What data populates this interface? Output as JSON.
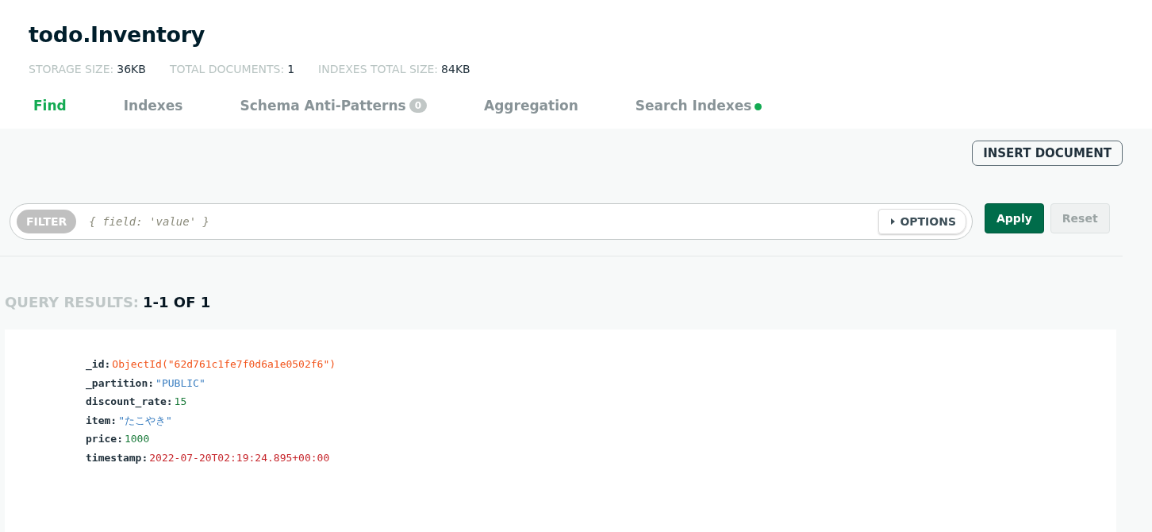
{
  "collection": {
    "title": "todo.Inventory",
    "stats": [
      {
        "label": "STORAGE SIZE:",
        "value": "36KB"
      },
      {
        "label": "TOTAL DOCUMENTS:",
        "value": "1"
      },
      {
        "label": "INDEXES TOTAL SIZE:",
        "value": "84KB"
      }
    ]
  },
  "tabs": [
    {
      "label": "Find",
      "selected": true,
      "status_dot": false
    },
    {
      "label": "Indexes",
      "selected": false,
      "status_dot": false
    },
    {
      "label": "Schema Anti-Patterns",
      "badge": "0",
      "selected": false,
      "status_dot": false
    },
    {
      "label": "Aggregation",
      "selected": false,
      "status_dot": false
    },
    {
      "label": "Search Indexes",
      "selected": false,
      "status_dot": true
    }
  ],
  "insert_button": "INSERT DOCUMENT",
  "filter": {
    "label": "FILTER",
    "placeholder": "{ field: 'value' }",
    "options": "OPTIONS",
    "options_expanded": false
  },
  "buttons": [
    {
      "label": "Apply",
      "disabled": false
    },
    {
      "label": "Reset",
      "disabled": true
    }
  ],
  "results": {
    "label": "QUERY RESULTS:",
    "count": "1-1 OF 1"
  },
  "document": [
    {
      "key": "_id:",
      "value": "ObjectId(\"62d761c1fe7f0d6a1e0502f6\")",
      "kind": "objectid"
    },
    {
      "key": "_partition:",
      "value": "\"PUBLIC\"",
      "kind": "string"
    },
    {
      "key": "discount_rate:",
      "value": "15",
      "kind": "number"
    },
    {
      "key": "item:",
      "value": "\"たこやき\"",
      "kind": "string"
    },
    {
      "key": "price:",
      "value": "1000",
      "kind": "number"
    },
    {
      "key": "timestamp:",
      "value": "2022-07-20T02:19:24.895+00:00",
      "kind": "date"
    }
  ]
}
